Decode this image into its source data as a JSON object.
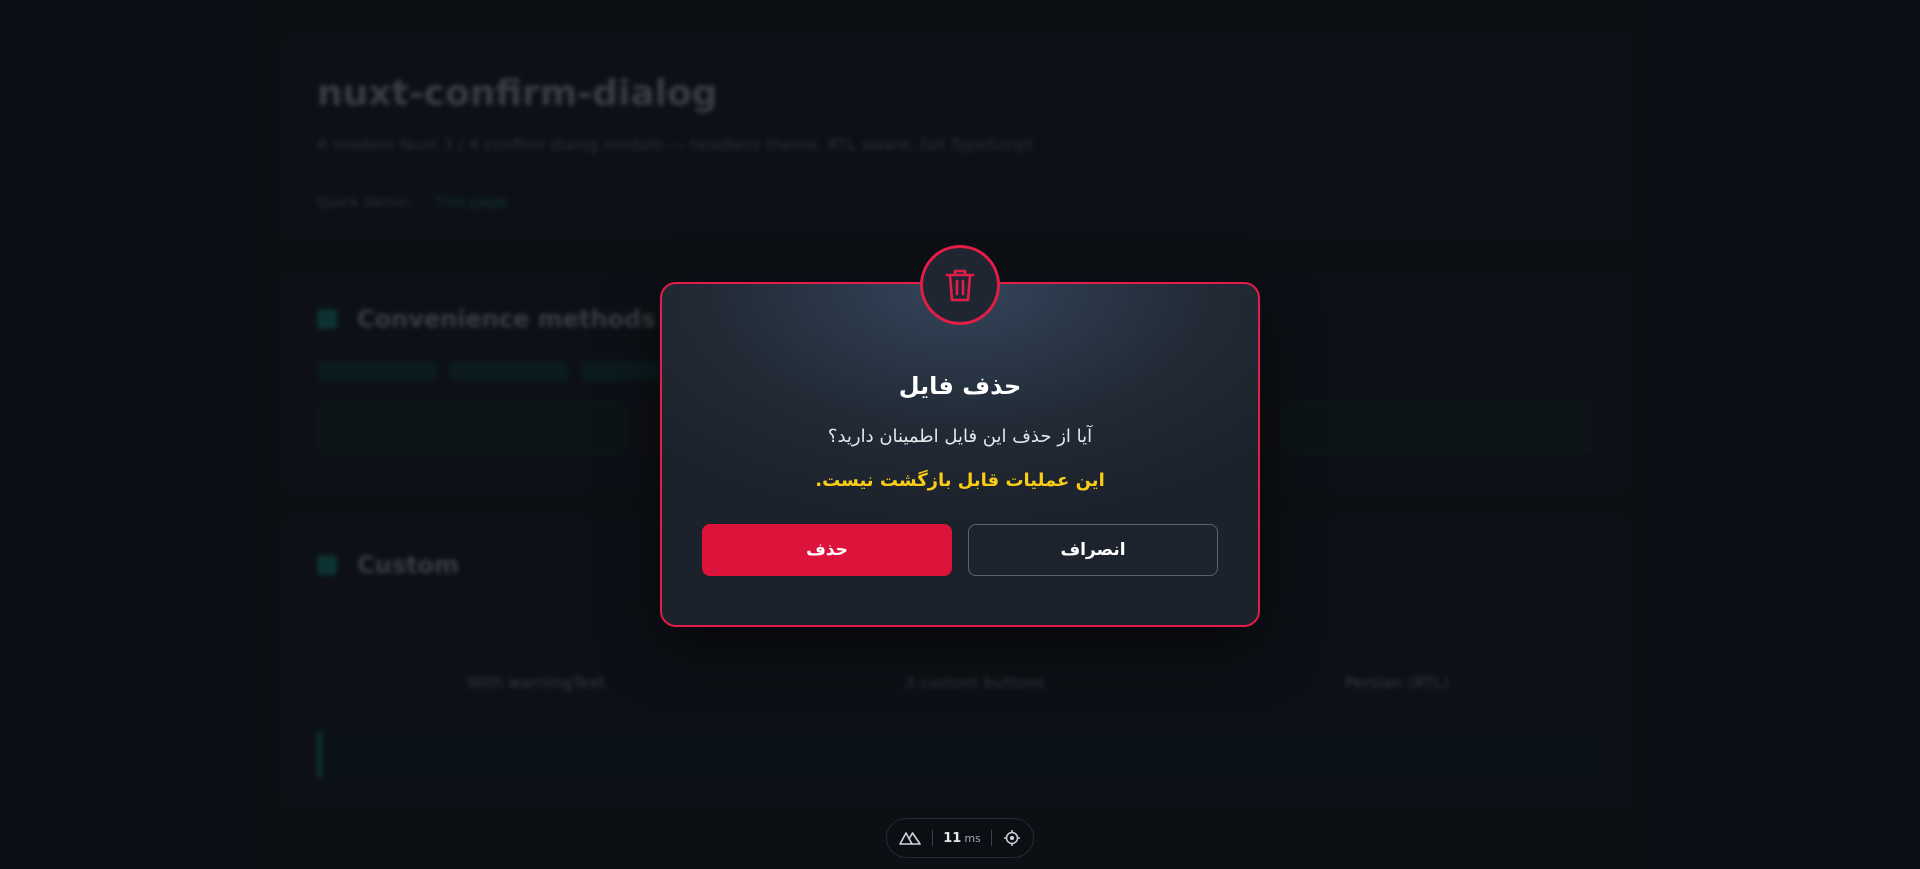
{
  "background": {
    "title": "nuxt-confirm-dialog",
    "subtitle": "A modern Nuxt 3 / 4 confirm dialog module — headless theme, RTL aware, full TypeScript",
    "quick_label": "Quick demo:",
    "quick_link": "This page",
    "convenience_title": "Convenience methods",
    "custom_title": "Custom",
    "custom_tabs": [
      "With warningText",
      "3 custom buttons",
      "Persian (RTL)"
    ]
  },
  "dialog": {
    "title": "حذف فایل",
    "message": "آیا از حذف این فایل اطمینان دارید؟",
    "warning": "این عملیات قابل بازگشت نیست.",
    "confirm_label": "حذف",
    "cancel_label": "انصراف",
    "icon": "trash-icon",
    "accent_color": "#e11d48",
    "warning_color": "#facc15"
  },
  "devtools": {
    "time_value": "11",
    "time_unit": "ms",
    "logo_icon": "nuxt-logo-icon",
    "inspect_icon": "target-icon"
  }
}
